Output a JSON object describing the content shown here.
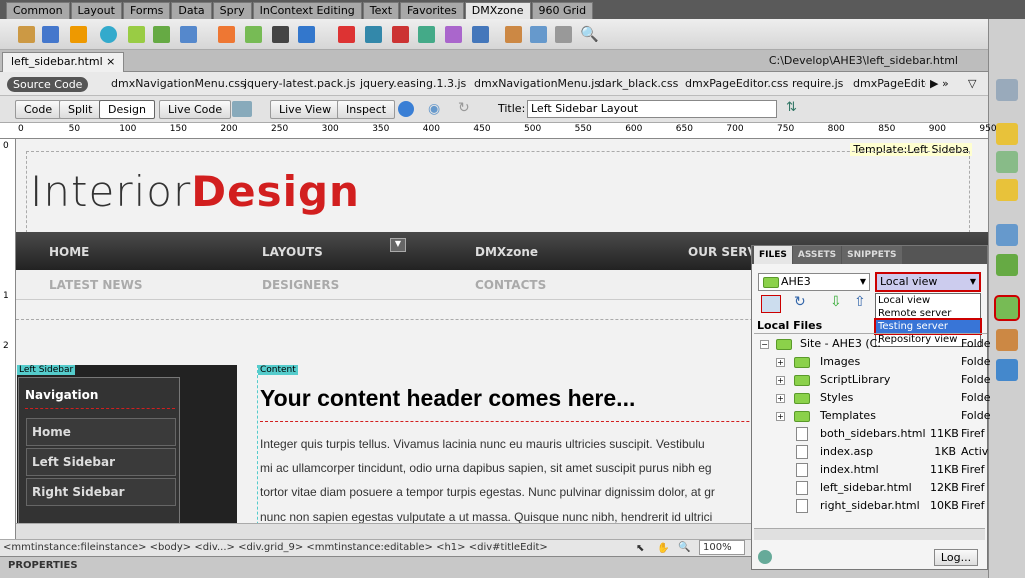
{
  "insert_tabs": [
    "Common",
    "Layout",
    "Forms",
    "Data",
    "Spry",
    "InContext Editing",
    "Text",
    "Favorites",
    "DMXzone",
    "960 Grid"
  ],
  "active_insert_tab": "DMXzone",
  "document": {
    "tab_name": "left_sidebar.html",
    "path": "C:\\Develop\\AHE3\\left_sidebar.html",
    "source_code_label": "Source Code",
    "related_files": [
      "dmxNavigationMenu.css",
      "jquery-latest.pack.js",
      "jquery.easing.1.3.js",
      "dmxNavigationMenu.js",
      "dark_black.css",
      "dmxPageEditor.css",
      "require.js",
      "dmxPageEditor"
    ]
  },
  "doc_toolbar": {
    "code": "Code",
    "split": "Split",
    "design": "Design",
    "live_code": "Live Code",
    "live_view": "Live View",
    "inspect": "Inspect",
    "title_label": "Title:",
    "title_value": "Left Sidebar Layout"
  },
  "ruler_h": [
    "0",
    "50",
    "100",
    "150",
    "200",
    "250",
    "300",
    "350",
    "400",
    "450",
    "500",
    "550",
    "600",
    "650",
    "700",
    "750",
    "800",
    "850",
    "900",
    "950"
  ],
  "ruler_v": [
    "0",
    "1",
    "2"
  ],
  "page": {
    "logo_part1": "Interior",
    "logo_part2": "Design",
    "template_label": "Template:Left Sideba",
    "nav_row1": [
      "HOME",
      "LAYOUTS",
      "DMXzone",
      "OUR SERVI"
    ],
    "nav_row2": [
      "LATEST NEWS",
      "DESIGNERS",
      "CONTACTS"
    ],
    "left_sidebar_tag": "Left Sidebar",
    "content_tag": "Content",
    "navigation_heading": "Navigation",
    "nav_items": [
      "Home",
      "Left Sidebar",
      "Right Sidebar"
    ],
    "content_header": "Your content header comes here...",
    "paragraph_lines": [
      "Integer quis turpis tellus. Vivamus lacinia nunc eu mauris ultricies suscipit. Vestibulu",
      "mi ac ullamcorper tincidunt, odio urna dapibus sapien, sit amet suscipit purus nibh eg",
      "tortor vitae diam posuere a tempor turpis egestas. Nunc pulvinar dignissim dolor, at gr",
      "nunc non sapien egestas vulputate a ut massa. Quisque nunc nibh, hendrerit id ultrici"
    ]
  },
  "status_bar": {
    "tag_path": "<mmtinstance:fileinstance> <body> <div...> <div.grid_9> <mmtinstance:editable> <h1> <div#titleEdit>",
    "zoom": "100%"
  },
  "properties_label": "PROPERTIES",
  "files_panel": {
    "tabs": [
      "FILES",
      "ASSETS",
      "SNIPPETS"
    ],
    "site": "AHE3",
    "view": "Local view",
    "view_options": [
      "Local view",
      "Remote server",
      "Testing server",
      "Repository view"
    ],
    "selected_option": "Testing server",
    "local_files_header": "Local Files",
    "site_root": "Site - AHE3 (C:",
    "rows": [
      {
        "name": "Images",
        "size": "",
        "type": "Folde",
        "kind": "folder"
      },
      {
        "name": "ScriptLibrary",
        "size": "",
        "type": "Folde",
        "kind": "folder"
      },
      {
        "name": "Styles",
        "size": "",
        "type": "Folde",
        "kind": "folder"
      },
      {
        "name": "Templates",
        "size": "",
        "type": "Folde",
        "kind": "folder"
      },
      {
        "name": "both_sidebars.html",
        "size": "11KB",
        "type": "Firef",
        "kind": "file"
      },
      {
        "name": "index.asp",
        "size": "1KB",
        "type": "Activ",
        "kind": "file"
      },
      {
        "name": "index.html",
        "size": "11KB",
        "type": "Firef",
        "kind": "file"
      },
      {
        "name": "left_sidebar.html",
        "size": "12KB",
        "type": "Firef",
        "kind": "file"
      },
      {
        "name": "right_sidebar.html",
        "size": "10KB",
        "type": "Firef",
        "kind": "file"
      }
    ],
    "root_type": "Folde",
    "log_button": "Log..."
  }
}
